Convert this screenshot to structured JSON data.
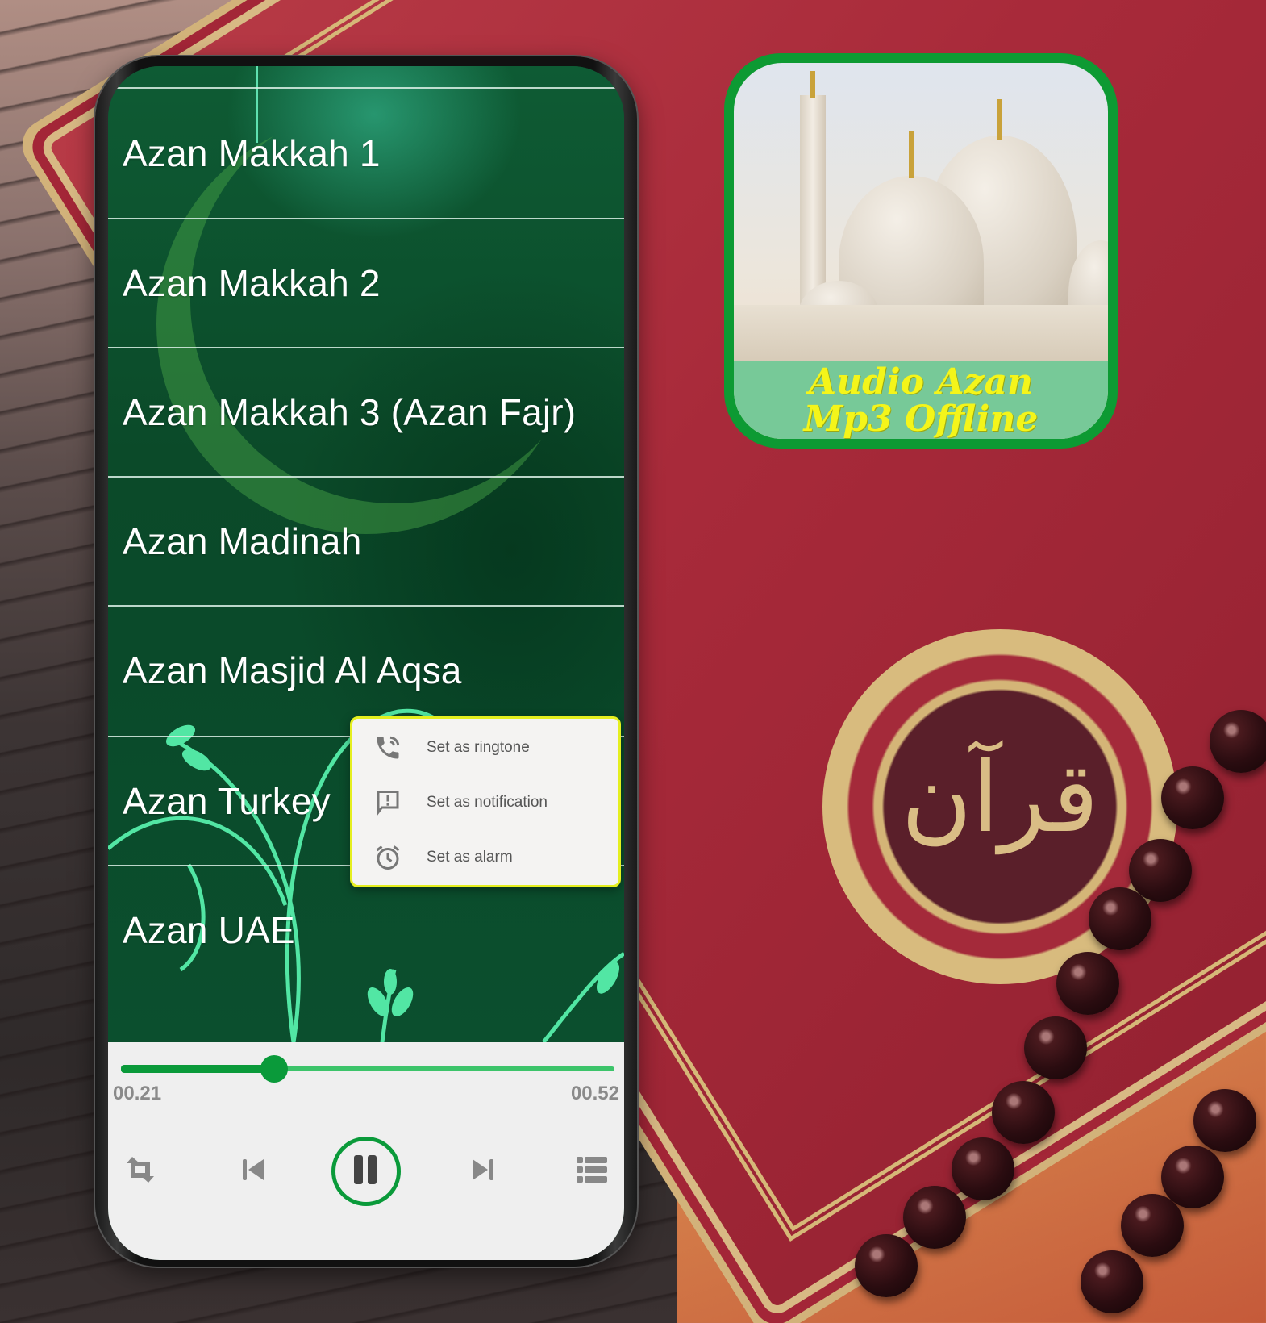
{
  "app_icon": {
    "title_line1": "Audio Azan",
    "title_line2": "Mp3 Offline",
    "border_color": "#0d9a33",
    "banner_color": "#77c998",
    "title_color": "#f4f51a"
  },
  "background": {
    "medallion_glyph": "قرآن"
  },
  "playlist": {
    "items": [
      {
        "label": "Azan Makkah 1"
      },
      {
        "label": "Azan Makkah 2"
      },
      {
        "label": "Azan Makkah 3 (Azan Fajr)"
      },
      {
        "label": "Azan Madinah"
      },
      {
        "label": "Azan Masjid Al Aqsa"
      },
      {
        "label": "Azan Turkey"
      },
      {
        "label": "Azan UAE"
      }
    ]
  },
  "context_menu": {
    "items": [
      {
        "label": "Set as ringtone",
        "icon": "phone-ringing-icon"
      },
      {
        "label": "Set as notification",
        "icon": "notification-icon"
      },
      {
        "label": "Set as alarm",
        "icon": "alarm-clock-icon"
      }
    ],
    "border_color": "#e5ef1f"
  },
  "player": {
    "current_time": "00.21",
    "total_time": "00.52",
    "progress": 0.31,
    "accent_color": "#0a9a3a",
    "track_color": "#3cc46a",
    "state": "playing",
    "controls": [
      "repeat-icon",
      "previous-icon",
      "pause-icon",
      "next-icon",
      "playlist-icon"
    ]
  }
}
